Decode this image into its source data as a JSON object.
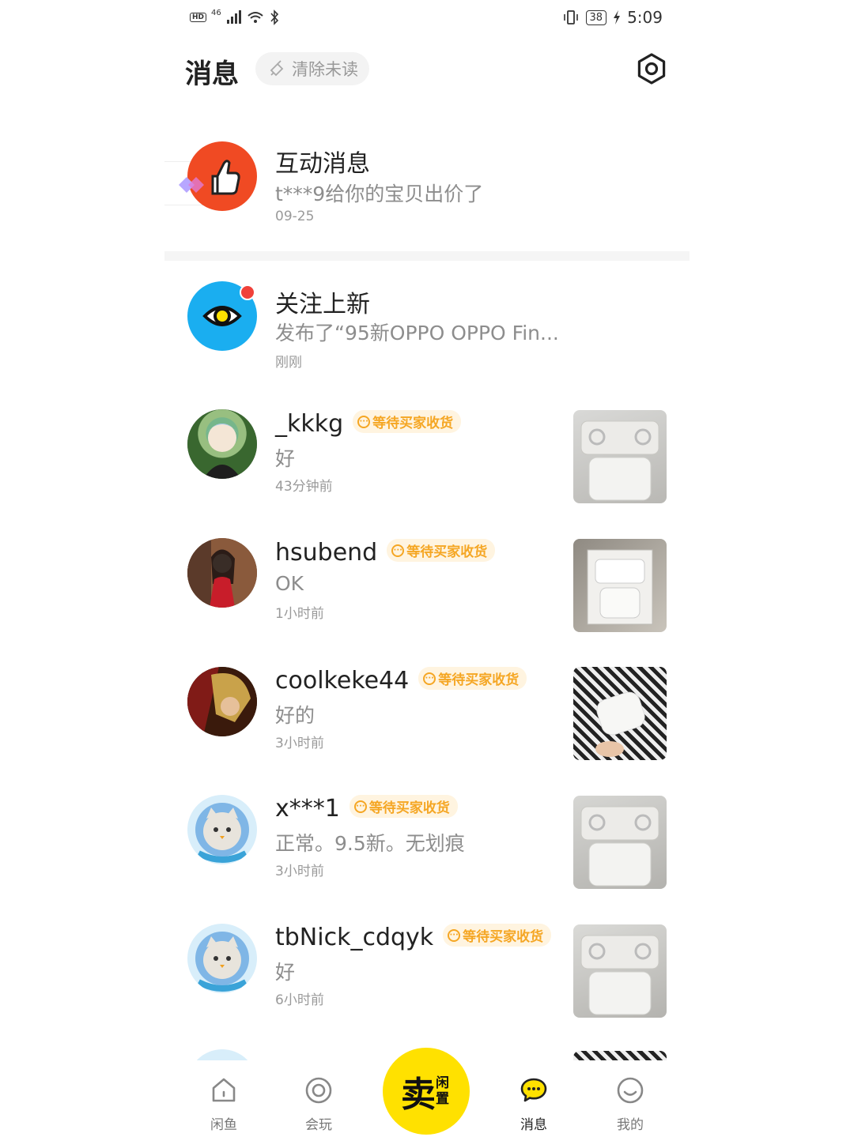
{
  "status_bar": {
    "network": "46",
    "battery": "38",
    "time": "5:09",
    "hd": "HD"
  },
  "header": {
    "title": "消息",
    "clear_label": "清除未读"
  },
  "system_rows": [
    {
      "name": "互动消息",
      "preview": "t***9给你的宝贝出价了",
      "time": "09-25"
    },
    {
      "name": "关注上新",
      "preview": "发布了“95新OPPO OPPO Fin...",
      "time": "刚刚"
    }
  ],
  "conversations": [
    {
      "name": "_kkkg",
      "badge": "等待买家收货",
      "preview": "好",
      "time": "43分钟前"
    },
    {
      "name": "hsubend",
      "badge": "等待买家收货",
      "preview": "OK",
      "time": "1小时前"
    },
    {
      "name": "coolkeke44",
      "badge": "等待买家收货",
      "preview": "好的",
      "time": "3小时前"
    },
    {
      "name": "x***1",
      "badge": "等待买家收货",
      "preview": "正常。9.5新。无划痕",
      "time": "3小时前"
    },
    {
      "name": "tbNick_cdqyk",
      "badge": "等待买家收货",
      "preview": "好",
      "time": "6小时前"
    }
  ],
  "nav": {
    "home": "闲鱼",
    "play": "会玩",
    "sell_big": "卖",
    "sell_small": "闲置",
    "messages": "消息",
    "mine": "我的"
  },
  "colors": {
    "accent": "#ffe100",
    "badge": "#f5a623",
    "like": "#f04a23",
    "follow": "#1aaef0"
  }
}
